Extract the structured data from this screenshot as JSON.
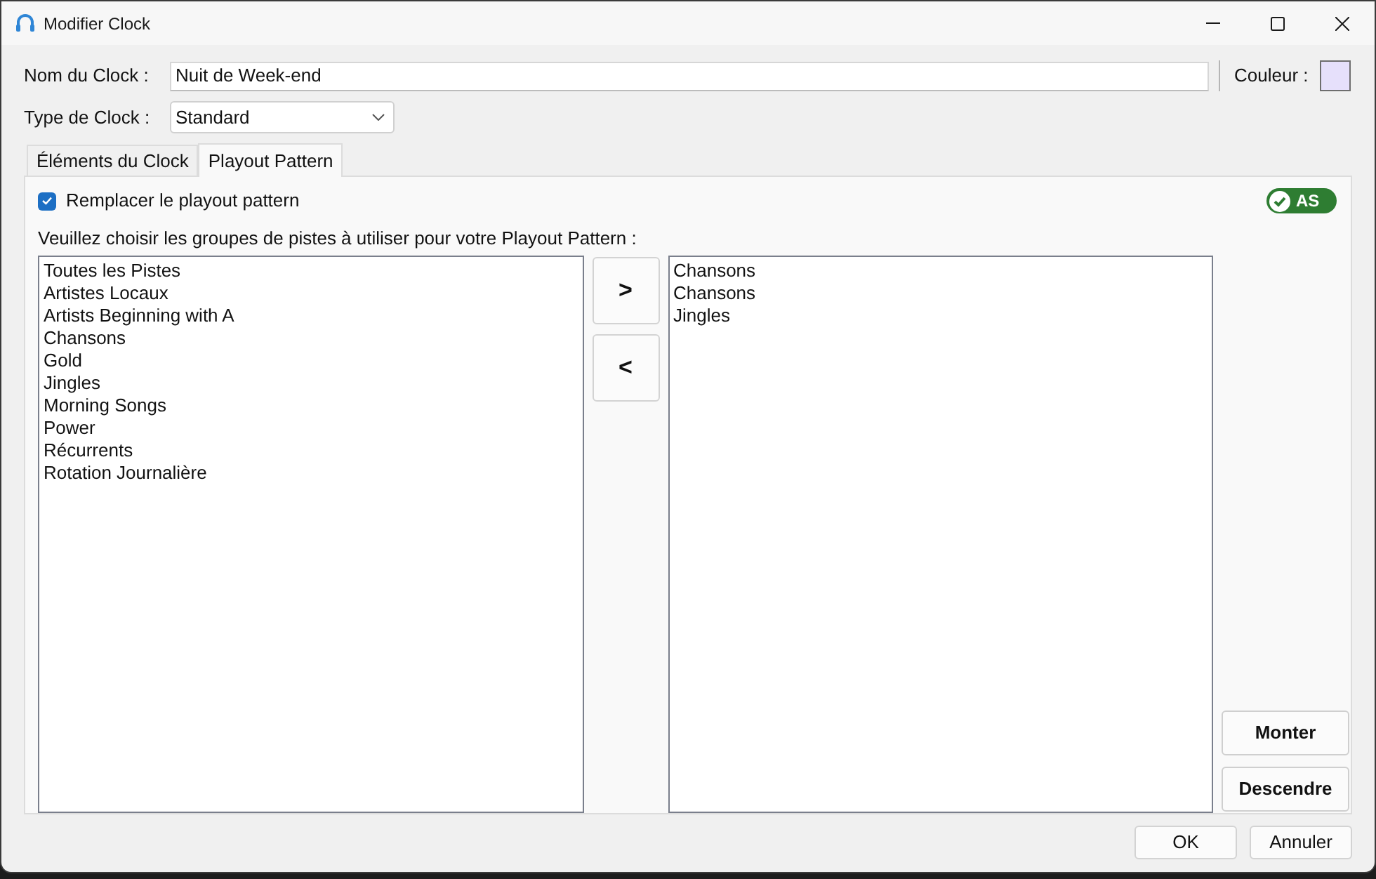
{
  "window": {
    "title": "Modifier Clock"
  },
  "name_field": {
    "label": "Nom du Clock :",
    "value": "Nuit de Week-end"
  },
  "color_field": {
    "label": "Couleur :",
    "color": "#e6e0fb"
  },
  "type_field": {
    "label": "Type de Clock :",
    "value": "Standard"
  },
  "tabs": [
    {
      "label": "Éléments du Clock",
      "selected": false
    },
    {
      "label": "Playout Pattern",
      "selected": true
    }
  ],
  "replace_checkbox": {
    "label": "Remplacer le playout pattern",
    "checked": true
  },
  "badge": {
    "label": "AS"
  },
  "instruction": "Veuillez choisir les groupes de pistes à utiliser pour votre Playout Pattern :",
  "available_groups": [
    "Toutes les Pistes",
    "Artistes Locaux",
    "Artists Beginning with A",
    "Chansons",
    "Gold",
    "Jingles",
    "Morning Songs",
    "Power",
    "Récurrents",
    "Rotation Journalière"
  ],
  "move_buttons": [
    ">",
    "<"
  ],
  "selected_groups": [
    "Chansons",
    "Chansons",
    "Jingles"
  ],
  "order_buttons": [
    "Monter",
    "Descendre"
  ],
  "dialog_buttons": [
    "OK",
    "Annuler"
  ]
}
